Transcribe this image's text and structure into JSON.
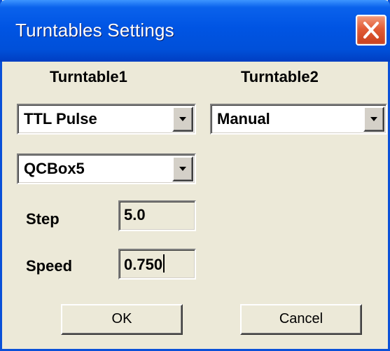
{
  "window": {
    "title": "Turntables Settings",
    "close_icon": "close-icon"
  },
  "turntable1": {
    "heading": "Turntable1",
    "mode_value": "TTL Pulse",
    "device_value": "QCBox5",
    "step_label": "Step",
    "step_value": "5.0",
    "speed_label": "Speed",
    "speed_value": "0.750"
  },
  "turntable2": {
    "heading": "Turntable2",
    "mode_value": "Manual"
  },
  "buttons": {
    "ok_label": "OK",
    "cancel_label": "Cancel"
  },
  "colors": {
    "titlebar": "#0054e3",
    "window_face": "#ece9d8",
    "close_button": "#e25c36"
  }
}
